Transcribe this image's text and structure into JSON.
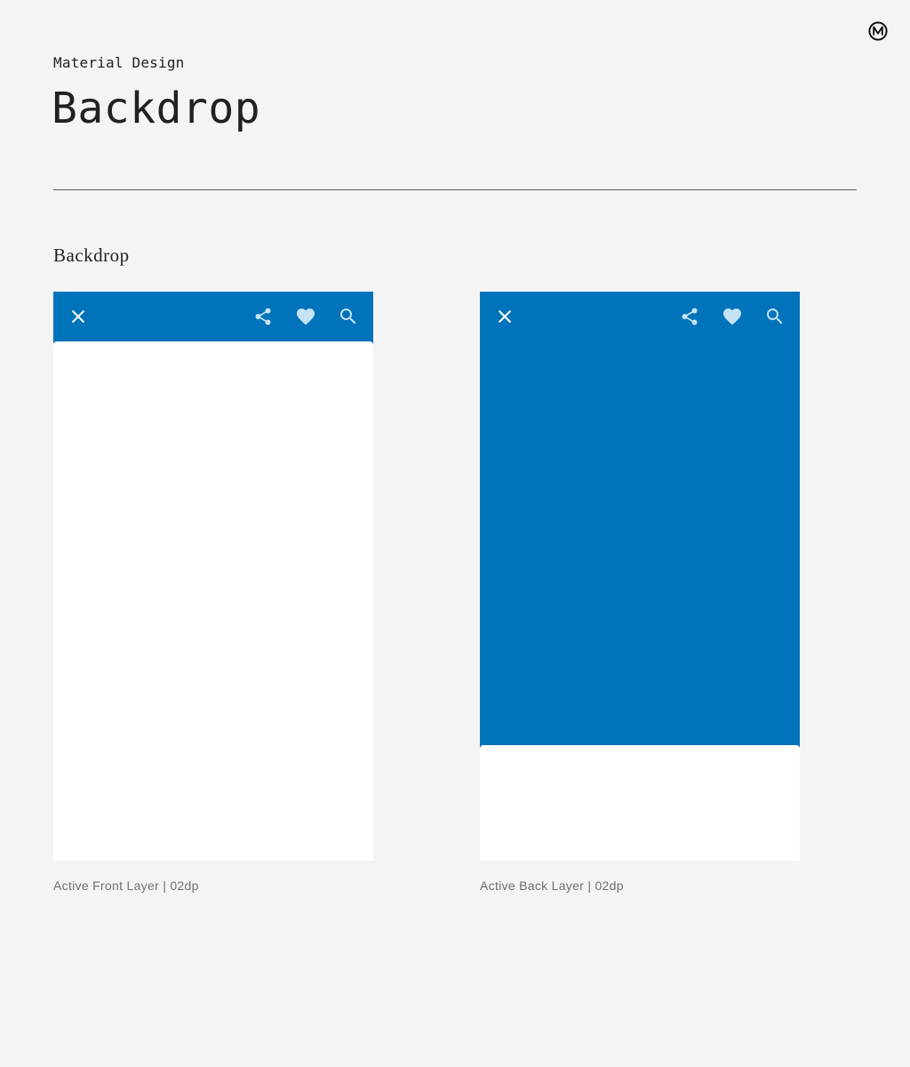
{
  "header": {
    "eyebrow": "Material Design",
    "title": "Backdrop",
    "logo_icon": "material-m-logo-icon"
  },
  "section": {
    "title": "Backdrop"
  },
  "colors": {
    "background": "#f4f4f4",
    "primary": "#0073ba",
    "surface": "#ffffff",
    "icon_tint": "#c6e3f5",
    "caption_text": "#6e6e6e"
  },
  "demos": [
    {
      "caption": "Active Front Layer | 02dp",
      "state": "front-layer-active",
      "app_bar": {
        "icons": [
          "close-icon",
          "share-icon",
          "heart-icon",
          "search-icon"
        ]
      }
    },
    {
      "caption": "Active Back Layer | 02dp",
      "state": "back-layer-active",
      "app_bar": {
        "icons": [
          "close-icon",
          "share-icon",
          "heart-icon",
          "search-icon"
        ]
      }
    }
  ]
}
